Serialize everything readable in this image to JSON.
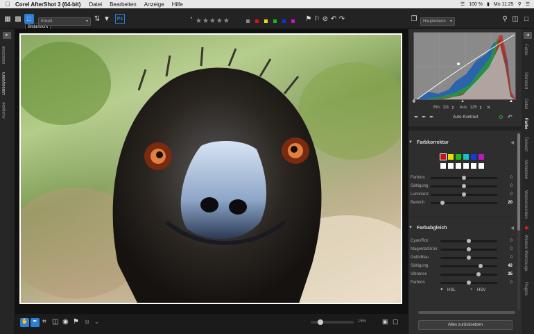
{
  "menubar": {
    "app": "Corel AfterShot 3 (64-bit)",
    "items": [
      "Datei",
      "Bearbeiten",
      "Anzeige",
      "Hilfe"
    ],
    "status": "100 %",
    "time": "Mo 11:25"
  },
  "toolbar": {
    "tooltip": "Bildansicht",
    "label_select": "Etikett",
    "layer_select": "Hauptebene",
    "ps_label": "Ps",
    "color_labels": [
      "#888888",
      "#e01010",
      "#e8e000",
      "#10c010",
      "#1030e0",
      "#d010d0"
    ]
  },
  "left_tabs": [
    "Bibliothek",
    "Dateisystem",
    "Ausgabe"
  ],
  "right_tabs": [
    "Farbe",
    "Standard",
    "Detail",
    "Farbe",
    "Tonwert",
    "Metadaten",
    "Wasserzeichen",
    "Weitere Werkzeuge",
    "Plugins"
  ],
  "histogram": {
    "in_label": "Ein:",
    "in_value": "111",
    "out_label": "Aus:",
    "out_value": "125",
    "auto_contrast": "Auto-Kontrast"
  },
  "farbkorrektur": {
    "title": "Farbkorrektur",
    "swatches": [
      "#c01818",
      "#e8e000",
      "#18c018",
      "#18c0c0",
      "#1838e0",
      "#c018c0"
    ],
    "sliders": [
      {
        "label": "Farbton",
        "value": "0",
        "fraction": 0.5
      },
      {
        "label": "Sättigung",
        "value": "0",
        "fraction": 0.5
      },
      {
        "label": "Luminanz",
        "value": "0",
        "fraction": 0.5
      },
      {
        "label": "Bereich",
        "value": "20",
        "fraction": 0.18
      }
    ]
  },
  "farbabgleich": {
    "title": "Farbabgleich",
    "sliders": [
      {
        "label": "Cyan/Rot",
        "value": "0",
        "fraction": 0.5
      },
      {
        "label": "Magenta/Grün",
        "value": "0",
        "fraction": 0.5
      },
      {
        "label": "Gelb/Blau",
        "value": "0",
        "fraction": 0.5
      },
      {
        "label": "Sättigung",
        "value": "42",
        "fraction": 0.71
      },
      {
        "label": "Vibrance",
        "value": "35",
        "fraction": 0.67
      },
      {
        "label": "Farbton",
        "value": "0",
        "fraction": 0.5
      }
    ],
    "mode_hsl": "HSL",
    "mode_hsv": "HSV"
  },
  "reset_button": "Alles zurücksetzen",
  "zoom": {
    "value": "15%",
    "fraction": 0.15
  }
}
